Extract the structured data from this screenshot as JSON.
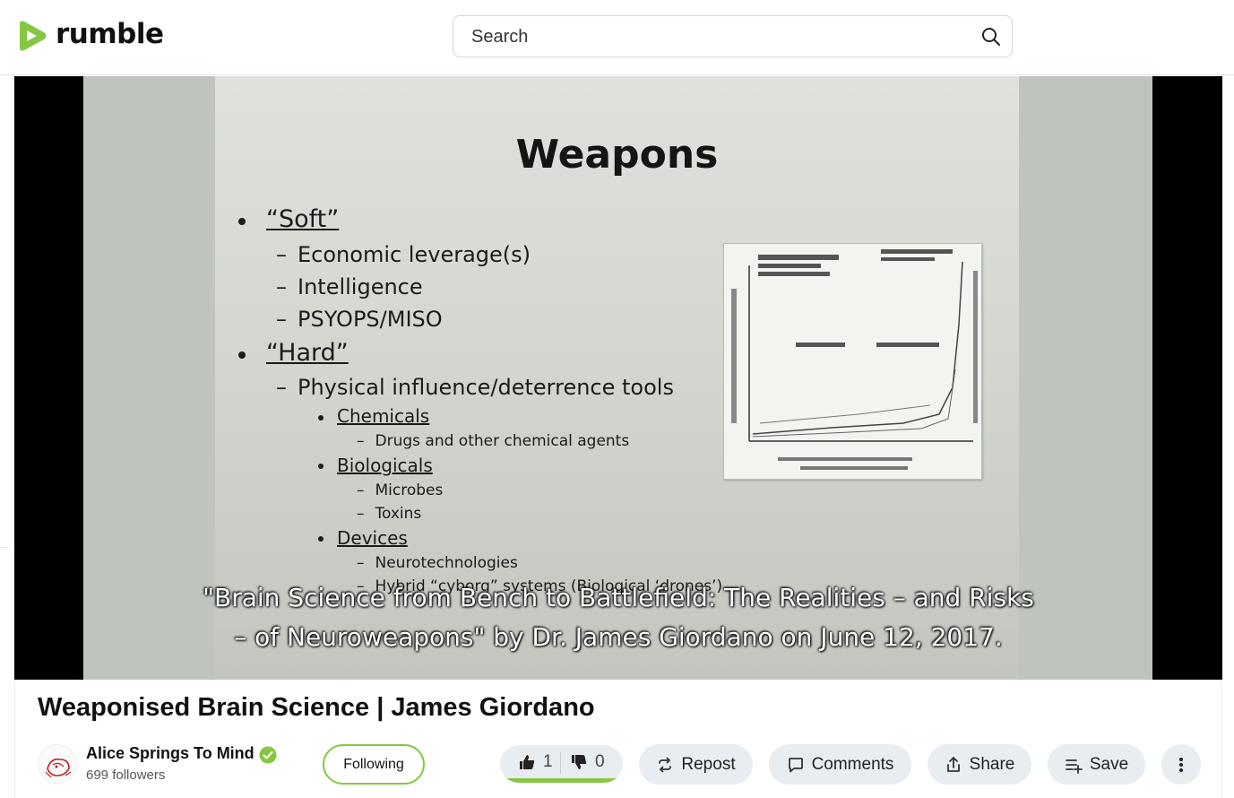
{
  "header": {
    "logo_text": "rumble",
    "search_placeholder": "Search"
  },
  "video": {
    "slide": {
      "title": "Weapons",
      "soft": "“Soft”",
      "soft_items": [
        "Economic leverage(s)",
        "Intelligence",
        "PSYOPS/MISO"
      ],
      "hard": "“Hard”",
      "hard_item": "Physical influence/deterrence tools",
      "chemicals": "Chemicals",
      "chemicals_sub": "Drugs and other chemical agents",
      "biologicals": "Biologicals",
      "biologicals_sub": [
        "Microbes",
        "Toxins"
      ],
      "devices": "Devices",
      "devices_sub": [
        "Neurotechnologies",
        "Hybrid “cyborg” systems (Biological ‘drones’)"
      ]
    },
    "caption_line1": "\"Brain Science from Bench to Battlefield: The Realities – and Risks",
    "caption_line2": "– of Neuroweapons\" by Dr. James Giordano on June 12, 2017."
  },
  "info": {
    "title": "Weaponised Brain Science | James Giordano",
    "channel_name": "Alice Springs To Mind",
    "followers": "699 followers",
    "follow_label": "Following",
    "likes": "1",
    "dislikes": "0",
    "like_ratio": 1.0,
    "repost_label": "Repost",
    "comments_label": "Comments",
    "share_label": "Share",
    "save_label": "Save"
  },
  "colors": {
    "brand_green": "#85c742",
    "pill_bg": "#e8edf1",
    "verified": "#85c742"
  },
  "icons": [
    "rumble-logo-icon",
    "search-icon",
    "verified-icon",
    "thumbs-up-icon",
    "thumbs-down-icon",
    "repost-icon",
    "comment-icon",
    "share-icon",
    "save-playlist-icon",
    "more-vertical-icon"
  ]
}
